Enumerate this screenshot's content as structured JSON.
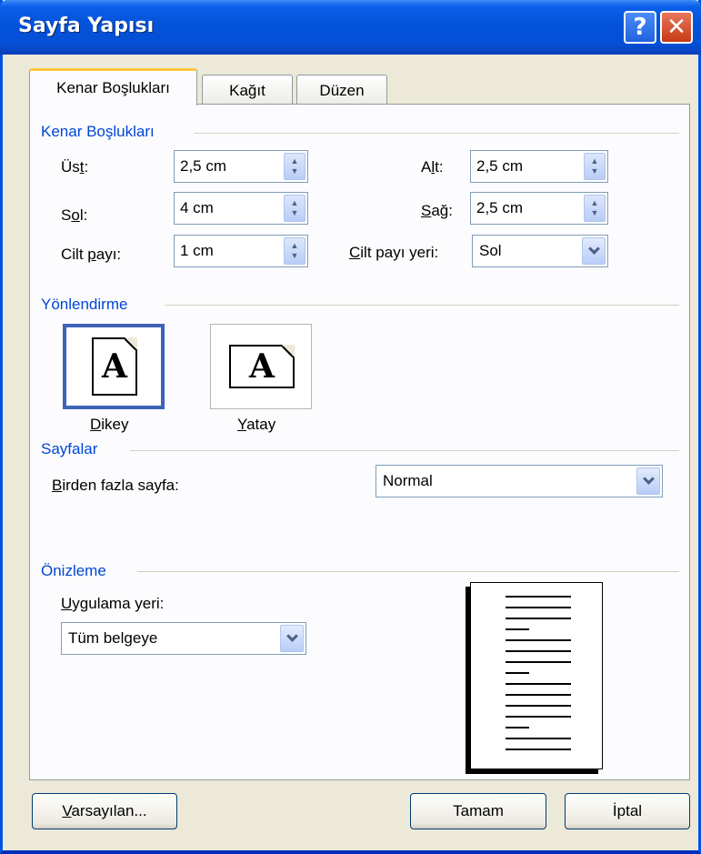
{
  "window": {
    "title": "Sayfa Yapısı",
    "help": "?",
    "close": "✕"
  },
  "tabs": [
    {
      "label": "Kenar Boşlukları"
    },
    {
      "label": "Kağıt"
    },
    {
      "label": "Düzen"
    }
  ],
  "margins": {
    "group": "Kenar Boşlukları",
    "top_label_a": "Üs",
    "top_label_u": "t",
    "top_label_b": ":",
    "top_value": "2,5 cm",
    "bottom_label_a": "A",
    "bottom_label_u": "l",
    "bottom_label_b": "t:",
    "bottom_value": "2,5 cm",
    "left_label_a": "S",
    "left_label_u": "o",
    "left_label_b": "l:",
    "left_value": "4 cm",
    "right_label_a": "",
    "right_label_u": "S",
    "right_label_b": "ağ:",
    "right_value": "2,5 cm",
    "gutter_label_a": "Cilt ",
    "gutter_label_u": "p",
    "gutter_label_b": "ayı:",
    "gutter_value": "1 cm",
    "gutterpos_label_a": "",
    "gutterpos_label_u": "C",
    "gutterpos_label_b": "ilt payı yeri:",
    "gutterpos_value": "Sol"
  },
  "orientation": {
    "group": "Yönlendirme",
    "portrait_a": "",
    "portrait_u": "D",
    "portrait_b": "ikey",
    "landscape_a": "",
    "landscape_u": "Y",
    "landscape_b": "atay",
    "icon_letter": "A",
    "selected": "portrait"
  },
  "pages": {
    "group": "Sayfalar",
    "multi_label_a": "",
    "multi_label_u": "B",
    "multi_label_b": "irden fazla sayfa:",
    "multi_value": "Normal"
  },
  "preview": {
    "group": "Önizleme",
    "apply_label_a": "",
    "apply_label_u": "U",
    "apply_label_b": "ygulama yeri:",
    "apply_value": "Tüm belgeye"
  },
  "buttons": {
    "default_u": "V",
    "default_b": "arsayılan...",
    "ok": "Tamam",
    "cancel": "İptal"
  },
  "colors": {
    "title_bar": "#0452d9",
    "group_label": "#0046d5",
    "active_tab_accent": "#ffc83c"
  }
}
